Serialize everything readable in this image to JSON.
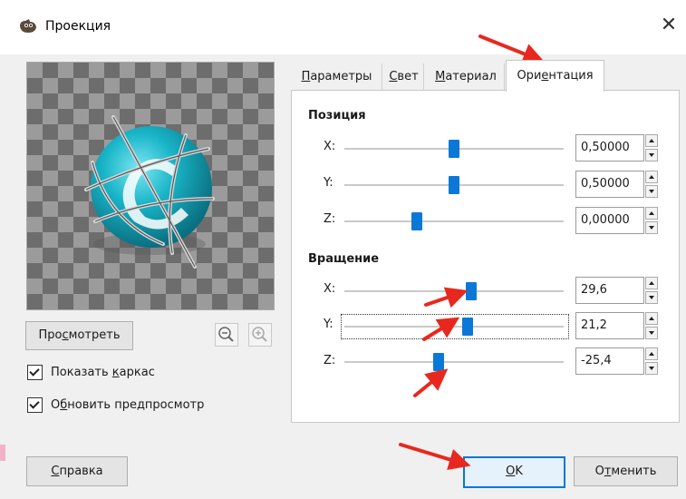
{
  "window": {
    "title": "Проекция",
    "close_icon": "close-icon",
    "app_icon": "gimp-icon"
  },
  "preview": {
    "preview_button": {
      "pre": "Про",
      "accel": "с",
      "post": "мотреть"
    },
    "zoom_out_icon": "zoom-out-icon",
    "zoom_in_icon": "zoom-in-icon",
    "show_wireframe": {
      "pre": "Показать ",
      "accel": "к",
      "post": "аркас",
      "checked": true
    },
    "update_preview": {
      "pre": "О",
      "accel": "б",
      "post": "новить предпросмотр",
      "checked": true
    }
  },
  "tabs": [
    {
      "accel": "П",
      "rest": "араметры",
      "active": false
    },
    {
      "accel": "С",
      "rest": "вет",
      "active": false
    },
    {
      "accel": "М",
      "rest": "атериал",
      "active": false
    },
    {
      "pre": "Ори",
      "accel": "е",
      "rest": "нтация",
      "active": true
    }
  ],
  "orientation": {
    "position": {
      "title": "Позиция",
      "rows": [
        {
          "label": "X:",
          "value": "0,50000",
          "level": 0.5
        },
        {
          "label": "Y:",
          "value": "0,50000",
          "level": 0.5
        },
        {
          "label": "Z:",
          "value": "0,00000",
          "level": 0.33
        }
      ]
    },
    "rotation": {
      "title": "Вращение",
      "rows": [
        {
          "label": "X:",
          "value": "29,6",
          "level": 0.58
        },
        {
          "label": "Y:",
          "value": "21,2",
          "level": 0.56
        },
        {
          "label": "Z:",
          "value": "-25,4",
          "level": 0.43
        }
      ]
    }
  },
  "footer": {
    "help": {
      "accel": "С",
      "rest": "правка"
    },
    "ok": {
      "accel": "О",
      "rest": "K"
    },
    "cancel": {
      "pre": "О",
      "accel": "т",
      "rest": "менить"
    }
  },
  "colors": {
    "accent": "#0b78d7",
    "annotation_arrow": "#e8281e",
    "sphere": "#19b5c8"
  }
}
